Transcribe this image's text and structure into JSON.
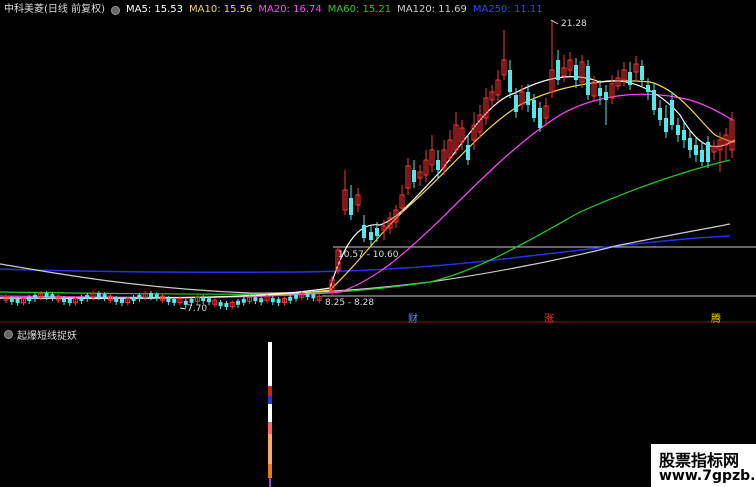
{
  "legend": {
    "stock_title": "中科美菱(日线 前复权)",
    "ma_items": [
      {
        "label": "MA5: 15.53",
        "color": "#ffffff"
      },
      {
        "label": "MA10: 15.56",
        "color": "#f2d64a"
      },
      {
        "label": "MA20: 16.74",
        "color": "#ff44ff"
      },
      {
        "label": "MA60: 15.21",
        "color": "#22cc22"
      },
      {
        "label": "MA120: 11.69",
        "color": "#cccccc"
      },
      {
        "label": "MA250: 11.11",
        "color": "#2233ee"
      }
    ]
  },
  "annotations": {
    "high_price": "21.28",
    "low_price": "7.70",
    "range_upper": "10.57 - 10.60",
    "range_lower": "8.25 - 8.28"
  },
  "events": [
    {
      "label": "财",
      "color": "#6688ff"
    },
    {
      "label": "涨",
      "color": "#ff3333"
    },
    {
      "label": "腾",
      "color": "#ffcc00"
    }
  ],
  "sub_panel": {
    "indicator_name": "起爆短线捉妖"
  },
  "watermark": {
    "line1": "股票指标网",
    "line2": "www.7gpzb.com"
  },
  "colors": {
    "up": "#ff3333",
    "down": "#55e8e8",
    "hline": "#c8c8c8"
  },
  "chart_data": {
    "type": "candlestick",
    "period": "daily",
    "adjustment": "前复权",
    "price_labels": {
      "high": 21.28,
      "low": 7.7
    },
    "support_resistance": [
      [
        10.57,
        10.6
      ],
      [
        8.25,
        8.28
      ]
    ],
    "series": [
      {
        "name": "MA5",
        "last": 15.53
      },
      {
        "name": "MA10",
        "last": 15.56
      },
      {
        "name": "MA20",
        "last": 16.74
      },
      {
        "name": "MA60",
        "last": 15.21
      },
      {
        "name": "MA120",
        "last": 11.69
      },
      {
        "name": "MA250",
        "last": 11.11
      }
    ],
    "events": [
      "财",
      "涨",
      "腾"
    ]
  }
}
